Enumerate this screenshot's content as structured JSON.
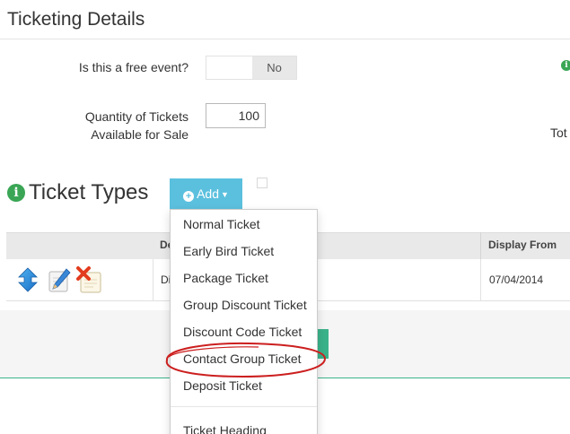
{
  "section": {
    "title": "Ticketing Details"
  },
  "free_event": {
    "label": "Is this a free event?",
    "toggle_value": "No"
  },
  "quantity": {
    "label_line1": "Quantity of Tickets",
    "label_line2": "Available for Sale",
    "value": "100"
  },
  "right_cut": {
    "total_label": "Tot"
  },
  "ticket_types": {
    "title": "Ticket Types",
    "add_label": "Add"
  },
  "table": {
    "headers": {
      "description": "De",
      "display_from": "Display From"
    },
    "row": {
      "description": "Di",
      "display_from": "07/04/2014"
    }
  },
  "dropdown": {
    "items": [
      "Normal Ticket",
      "Early Bird Ticket",
      "Package Ticket",
      "Group Discount Ticket",
      "Discount Code Ticket",
      "Contact Group Ticket",
      "Deposit Ticket",
      "Ticket Heading"
    ]
  },
  "colors": {
    "add_button": "#5bc0de",
    "info_icon": "#3aa655",
    "accent_green": "#3bb38a",
    "highlight_oval": "#cc1f1f"
  },
  "icons": {
    "sort": "up-down-arrows-icon",
    "edit": "pencil-edit-icon",
    "delete": "delete-x-icon",
    "info": "info-icon"
  }
}
